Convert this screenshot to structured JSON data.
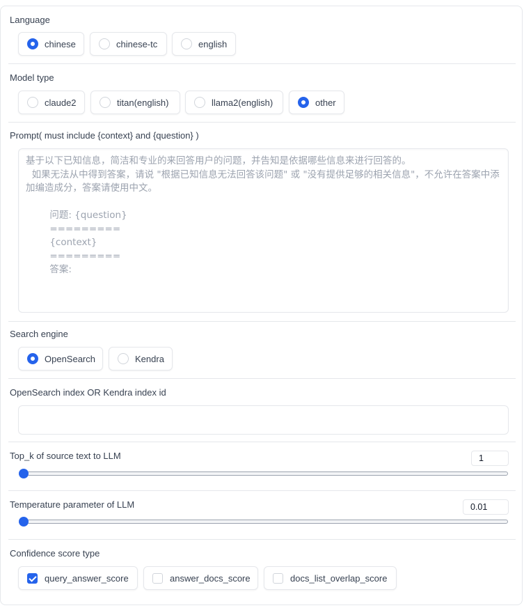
{
  "language": {
    "label": "Language",
    "options": [
      "chinese",
      "chinese-tc",
      "english"
    ],
    "selected": "chinese"
  },
  "model_type": {
    "label": "Model type",
    "options": [
      "claude2",
      "titan(english)",
      "llama2(english)",
      "other"
    ],
    "selected": "other"
  },
  "prompt": {
    "label": "Prompt( must include {context} and {question} )",
    "placeholder": "基于以下已知信息，简洁和专业的来回答用户的问题，并告知是依据哪些信息来进行回答的。\n  如果无法从中得到答案，请说 \"根据已知信息无法回答该问题\" 或 \"没有提供足够的相关信息\"，不允许在答案中添加编造成分，答案请使用中文。\n\n        问题: {question}\n        =========\n        {context}\n        =========\n        答案:"
  },
  "search_engine": {
    "label": "Search engine",
    "options": [
      "OpenSearch",
      "Kendra"
    ],
    "selected": "OpenSearch"
  },
  "index": {
    "label": "OpenSearch index OR Kendra index id",
    "value": ""
  },
  "top_k": {
    "label": "Top_k of source text to LLM",
    "value": "1"
  },
  "temperature": {
    "label": "Temperature parameter of LLM",
    "value": "0.01"
  },
  "confidence": {
    "label": "Confidence score type",
    "options": [
      "query_answer_score",
      "answer_docs_score",
      "docs_list_overlap_score"
    ],
    "checked": [
      "query_answer_score"
    ]
  },
  "colors": {
    "accent": "#2563eb",
    "border": "#e5e7eb",
    "text": "#374151",
    "placeholder": "#9ca3af"
  }
}
